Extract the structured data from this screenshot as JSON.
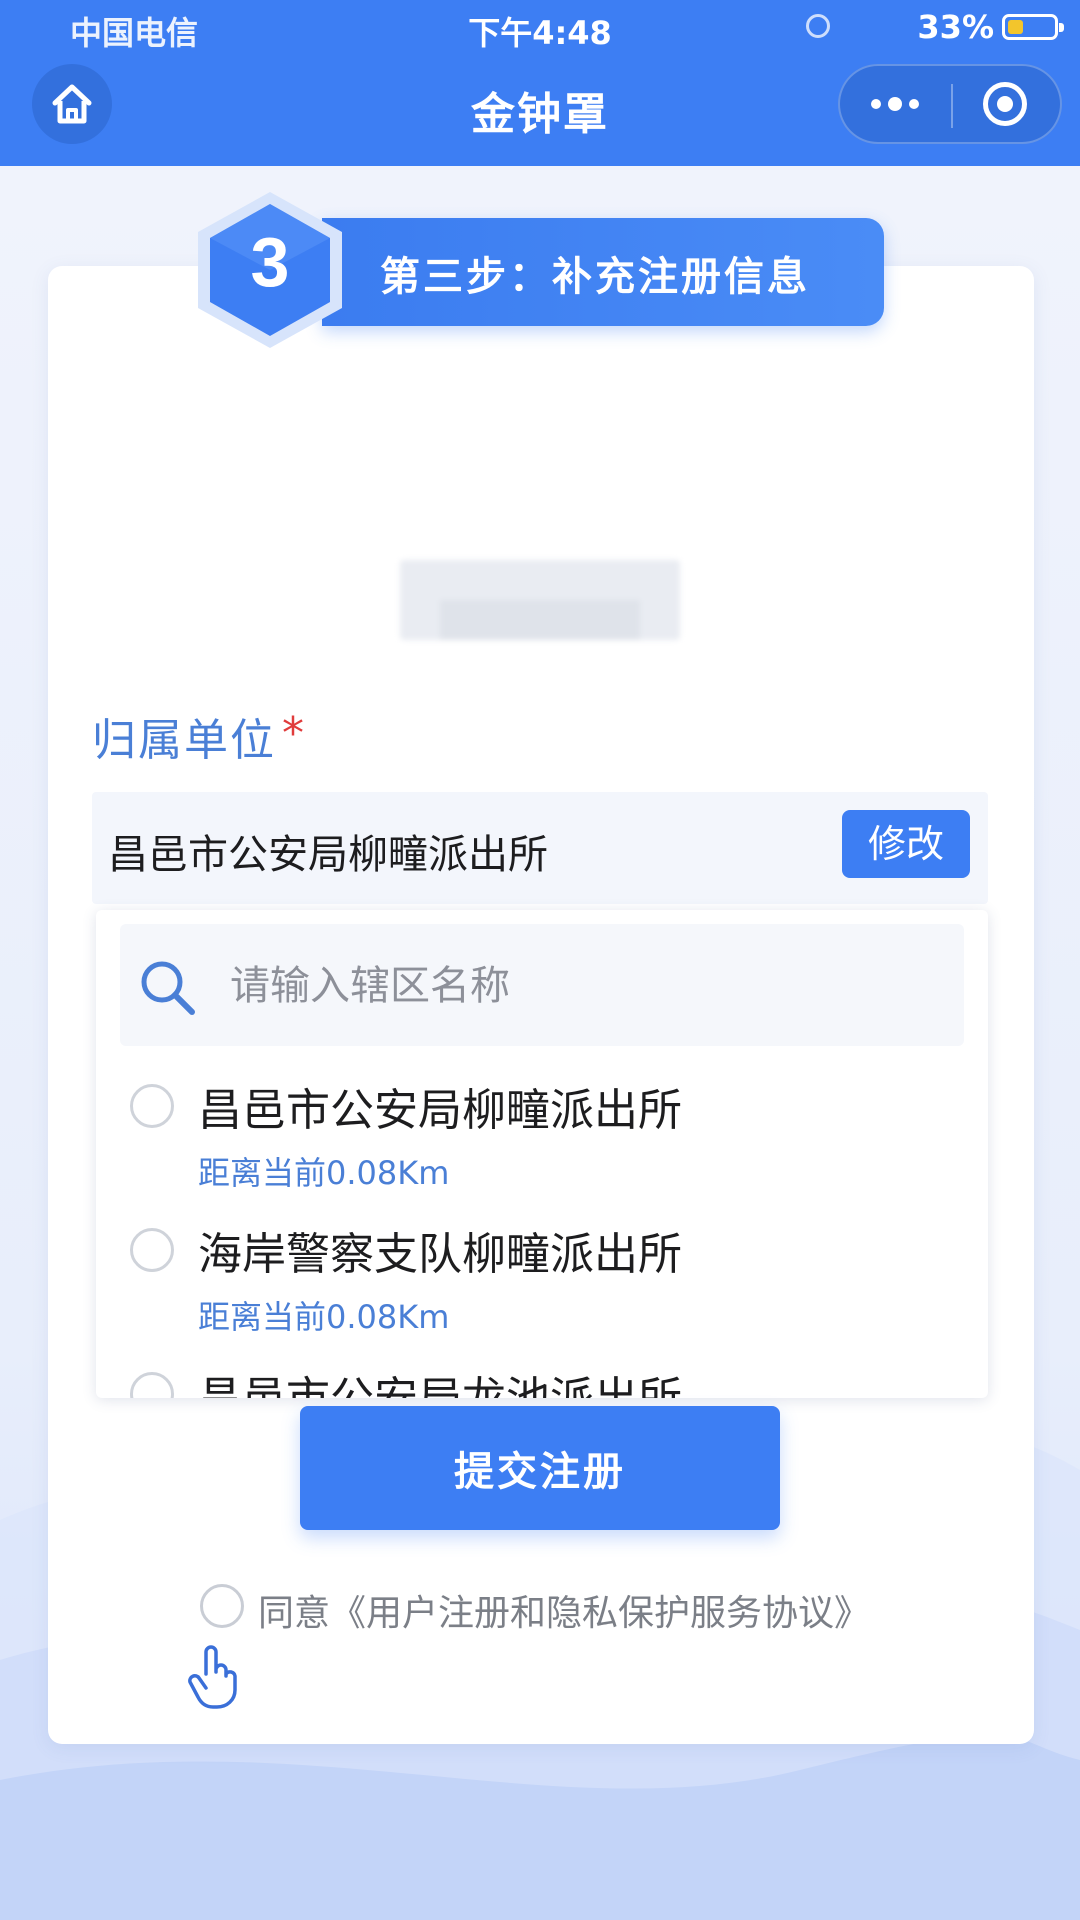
{
  "status_bar": {
    "carrier": "中国电信",
    "time": "下午4:48",
    "battery_percent": "33%",
    "battery_level": 0.33
  },
  "nav": {
    "title": "金钟罩"
  },
  "step": {
    "number": "3",
    "title": "第三步：补充注册信息"
  },
  "form": {
    "unit_label": "归属单位",
    "required_mark": "*",
    "selected_unit": "昌邑市公安局柳疃派出所",
    "modify_label": "修改",
    "search_placeholder": "请输入辖区名称",
    "options": [
      {
        "name": "昌邑市公安局柳疃派出所",
        "distance": "距离当前0.08Km"
      },
      {
        "name": "海岸警察支队柳疃派出所",
        "distance": "距离当前0.08Km"
      },
      {
        "name": "昌邑市公安局龙池派出所",
        "distance": ""
      }
    ]
  },
  "submit_label": "提交注册",
  "agreement_text": "同意《用户注册和隐私保护服务协议》",
  "colors": {
    "primary": "#3d7ef3",
    "label_blue": "#4a7fd6",
    "required_red": "#e03c3c"
  }
}
